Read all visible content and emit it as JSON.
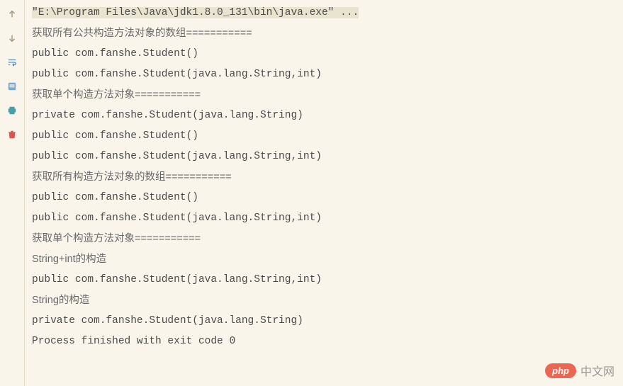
{
  "gutter": {
    "icons": [
      {
        "name": "arrow-up-icon"
      },
      {
        "name": "arrow-down-icon"
      },
      {
        "name": "soft-wrap-icon"
      },
      {
        "name": "scroll-to-end-icon"
      },
      {
        "name": "print-icon"
      },
      {
        "name": "trash-icon"
      }
    ]
  },
  "console": {
    "command": "\"E:\\Program Files\\Java\\jdk1.8.0_131\\bin\\java.exe\" ...",
    "lines": [
      {
        "text": "获取所有公共构造方法对象的数组===========",
        "chinese": true
      },
      {
        "text": "public com.fanshe.Student()"
      },
      {
        "text": "public com.fanshe.Student(java.lang.String,int)"
      },
      {
        "text": "获取单个构造方法对象===========",
        "chinese": true
      },
      {
        "text": "private com.fanshe.Student(java.lang.String)"
      },
      {
        "text": "public com.fanshe.Student()"
      },
      {
        "text": "public com.fanshe.Student(java.lang.String,int)"
      },
      {
        "text": "获取所有构造方法对象的数组===========",
        "chinese": true
      },
      {
        "text": "public com.fanshe.Student()"
      },
      {
        "text": "public com.fanshe.Student(java.lang.String,int)"
      },
      {
        "text": "获取单个构造方法对象===========",
        "chinese": true
      },
      {
        "text": "String+int的构造",
        "chinese": true
      },
      {
        "text": "public com.fanshe.Student(java.lang.String,int)"
      },
      {
        "text": "String的构造",
        "chinese": true
      },
      {
        "text": "private com.fanshe.Student(java.lang.String)"
      },
      {
        "text": ""
      },
      {
        "text": "Process finished with exit code 0"
      }
    ]
  },
  "watermark": {
    "badge": "php",
    "text": "中文网"
  }
}
